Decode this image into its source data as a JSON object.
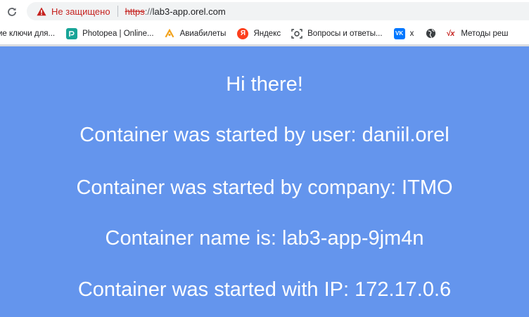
{
  "browser": {
    "security_label": "Не защищено",
    "url_scheme": "https",
    "url_separator": "://",
    "url_host": "lab3-app.orel.com"
  },
  "bookmarks": [
    {
      "label": "ие ключи для...",
      "icon": "none"
    },
    {
      "label": "Photopea | Online...",
      "icon": "photopea-icon"
    },
    {
      "label": "Авиабилеты",
      "icon": "aviasales-icon"
    },
    {
      "label": "Яндекс",
      "icon": "yandex-icon"
    },
    {
      "label": "Вопросы и ответы...",
      "icon": "qa-icon"
    },
    {
      "label": "x",
      "icon": "vk-icon"
    },
    {
      "label": "",
      "icon": "globe-icon"
    },
    {
      "label": "Методы реш",
      "icon": "math-icon"
    }
  ],
  "page": {
    "greeting": "Hi there!",
    "user_line": "Container was started by user: daniil.orel",
    "company_line": "Container was started by company: ITMO",
    "name_line": "Container name is: lab3-app-9jm4n",
    "ip_line": "Container was started with IP: 172.17.0.6"
  },
  "colors": {
    "page_background": "#6495ed",
    "text": "#ffffff",
    "not_secure": "#c5221f"
  }
}
